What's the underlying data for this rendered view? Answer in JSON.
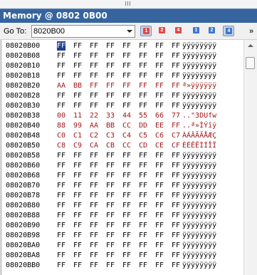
{
  "window": {
    "title": "Memory @ 0802 0B00"
  },
  "toolbar": {
    "goto_label": "Go To:",
    "address_value": "8020B00",
    "buttons": [
      {
        "icon": "size-1-byte-icon",
        "label": "1",
        "color": "red",
        "active": true
      },
      {
        "icon": "size-2-byte-icon",
        "label": "2",
        "color": "red",
        "active": false
      },
      {
        "icon": "size-4-byte-icon",
        "label": "4",
        "color": "red",
        "active": false
      },
      {
        "icon": "size-1-byte-alt-icon",
        "label": "1",
        "color": "blue",
        "active": false
      },
      {
        "icon": "size-2-byte-alt-icon",
        "label": "2",
        "color": "blue",
        "active": false
      },
      {
        "icon": "size-4-byte-alt-icon",
        "label": "4",
        "color": "blue",
        "active": true
      }
    ],
    "overflow_label": "»"
  },
  "colors": {
    "changed": "#a01818",
    "title_bar": "#35649e",
    "cursor": "#1f3f8f"
  },
  "memory": {
    "rows": [
      {
        "addr": "08020B00",
        "bytes": [
          "FF",
          "FF",
          "FF",
          "FF",
          "FF",
          "FF",
          "FF",
          "FF"
        ],
        "ascii": "ÿÿÿÿÿÿÿÿ",
        "changed": false
      },
      {
        "addr": "08020B08",
        "bytes": [
          "FF",
          "FF",
          "FF",
          "FF",
          "FF",
          "FF",
          "FF",
          "FF"
        ],
        "ascii": "ÿÿÿÿÿÿÿÿ",
        "changed": false
      },
      {
        "addr": "08020B10",
        "bytes": [
          "FF",
          "FF",
          "FF",
          "FF",
          "FF",
          "FF",
          "FF",
          "FF"
        ],
        "ascii": "ÿÿÿÿÿÿÿÿ",
        "changed": false
      },
      {
        "addr": "08020B18",
        "bytes": [
          "FF",
          "FF",
          "FF",
          "FF",
          "FF",
          "FF",
          "FF",
          "FF"
        ],
        "ascii": "ÿÿÿÿÿÿÿÿ",
        "changed": false
      },
      {
        "addr": "08020B20",
        "bytes": [
          "AA",
          "BB",
          "FF",
          "FF",
          "FF",
          "FF",
          "FF",
          "FF"
        ],
        "ascii": "ª»ÿÿÿÿÿÿ",
        "changed": true
      },
      {
        "addr": "08020B28",
        "bytes": [
          "FF",
          "FF",
          "FF",
          "FF",
          "FF",
          "FF",
          "FF",
          "FF"
        ],
        "ascii": "ÿÿÿÿÿÿÿÿ",
        "changed": false
      },
      {
        "addr": "08020B30",
        "bytes": [
          "FF",
          "FF",
          "FF",
          "FF",
          "FF",
          "FF",
          "FF",
          "FF"
        ],
        "ascii": "ÿÿÿÿÿÿÿÿ",
        "changed": false
      },
      {
        "addr": "08020B38",
        "bytes": [
          "00",
          "11",
          "22",
          "33",
          "44",
          "55",
          "66",
          "77"
        ],
        "ascii": "..\"3DUfw",
        "changed": true
      },
      {
        "addr": "08020B40",
        "bytes": [
          "88",
          "99",
          "AA",
          "BB",
          "CC",
          "DD",
          "EE",
          "FF"
        ],
        "ascii": "..ª»ÌÝîÿ",
        "changed": true
      },
      {
        "addr": "08020B48",
        "bytes": [
          "C0",
          "C1",
          "C2",
          "C3",
          "C4",
          "C5",
          "C6",
          "C7"
        ],
        "ascii": "ÀÁÂÃÄÅÆÇ",
        "changed": true
      },
      {
        "addr": "08020B50",
        "bytes": [
          "C8",
          "C9",
          "CA",
          "CB",
          "CC",
          "CD",
          "CE",
          "CF"
        ],
        "ascii": "ÈÉÊËÌÍÎÏ",
        "changed": true
      },
      {
        "addr": "08020B58",
        "bytes": [
          "FF",
          "FF",
          "FF",
          "FF",
          "FF",
          "FF",
          "FF",
          "FF"
        ],
        "ascii": "ÿÿÿÿÿÿÿÿ",
        "changed": false
      },
      {
        "addr": "08020B60",
        "bytes": [
          "FF",
          "FF",
          "FF",
          "FF",
          "FF",
          "FF",
          "FF",
          "FF"
        ],
        "ascii": "ÿÿÿÿÿÿÿÿ",
        "changed": false
      },
      {
        "addr": "08020B68",
        "bytes": [
          "FF",
          "FF",
          "FF",
          "FF",
          "FF",
          "FF",
          "FF",
          "FF"
        ],
        "ascii": "ÿÿÿÿÿÿÿÿ",
        "changed": false
      },
      {
        "addr": "08020B70",
        "bytes": [
          "FF",
          "FF",
          "FF",
          "FF",
          "FF",
          "FF",
          "FF",
          "FF"
        ],
        "ascii": "ÿÿÿÿÿÿÿÿ",
        "changed": false
      },
      {
        "addr": "08020B78",
        "bytes": [
          "FF",
          "FF",
          "FF",
          "FF",
          "FF",
          "FF",
          "FF",
          "FF"
        ],
        "ascii": "ÿÿÿÿÿÿÿÿ",
        "changed": false
      },
      {
        "addr": "08020B80",
        "bytes": [
          "FF",
          "FF",
          "FF",
          "FF",
          "FF",
          "FF",
          "FF",
          "FF"
        ],
        "ascii": "ÿÿÿÿÿÿÿÿ",
        "changed": false
      },
      {
        "addr": "08020B88",
        "bytes": [
          "FF",
          "FF",
          "FF",
          "FF",
          "FF",
          "FF",
          "FF",
          "FF"
        ],
        "ascii": "ÿÿÿÿÿÿÿÿ",
        "changed": false
      },
      {
        "addr": "08020B90",
        "bytes": [
          "FF",
          "FF",
          "FF",
          "FF",
          "FF",
          "FF",
          "FF",
          "FF"
        ],
        "ascii": "ÿÿÿÿÿÿÿÿ",
        "changed": false
      },
      {
        "addr": "08020B98",
        "bytes": [
          "FF",
          "FF",
          "FF",
          "FF",
          "FF",
          "FF",
          "FF",
          "FF"
        ],
        "ascii": "ÿÿÿÿÿÿÿÿ",
        "changed": false
      },
      {
        "addr": "08020BA0",
        "bytes": [
          "FF",
          "FF",
          "FF",
          "FF",
          "FF",
          "FF",
          "FF",
          "FF"
        ],
        "ascii": "ÿÿÿÿÿÿÿÿ",
        "changed": false
      },
      {
        "addr": "08020BA8",
        "bytes": [
          "FF",
          "FF",
          "FF",
          "FF",
          "FF",
          "FF",
          "FF",
          "FF"
        ],
        "ascii": "ÿÿÿÿÿÿÿÿ",
        "changed": false
      },
      {
        "addr": "08020BB0",
        "bytes": [
          "FF",
          "FF",
          "FF",
          "FF",
          "FF",
          "FF",
          "FF",
          "FF"
        ],
        "ascii": "ÿÿÿÿÿÿÿÿ",
        "changed": false
      }
    ]
  }
}
